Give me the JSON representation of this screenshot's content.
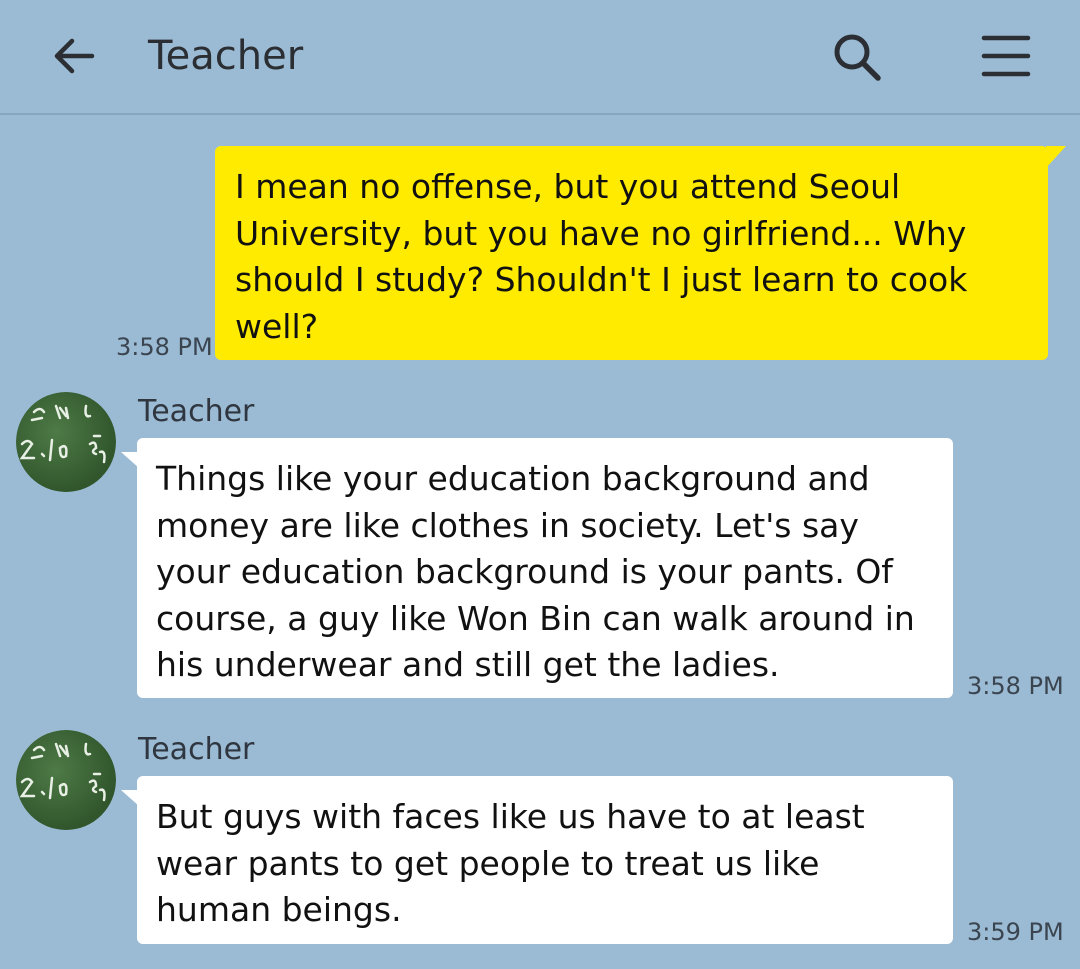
{
  "header": {
    "title": "Teacher",
    "back_icon": "arrow-left-icon",
    "search_icon": "search-icon",
    "menu_icon": "hamburger-menu-icon"
  },
  "colors": {
    "background": "#9bbbd4",
    "my_bubble": "#ffeb00",
    "their_bubble": "#ffffff"
  },
  "messages": [
    {
      "from": "me",
      "text": "I mean no offense, but you attend Seoul\nUniversity, but you have no girlfriend... Why\nshould I study? Shouldn't I just learn to cook\nwell?",
      "time": "3:58 PM"
    },
    {
      "from": "Teacher",
      "sender": "Teacher",
      "text": "Things like your education background and\nmoney are like clothes in society. Let's say\nyour education background is your pants. Of\ncourse, a guy like Won Bin can walk around in\nhis underwear and still get the ladies.",
      "time": "3:58 PM"
    },
    {
      "from": "Teacher",
      "sender": "Teacher",
      "text": "But guys with faces like us have to at least\nwear pants to get people to treat us like\nhuman beings.",
      "time": "3:59 PM"
    }
  ]
}
